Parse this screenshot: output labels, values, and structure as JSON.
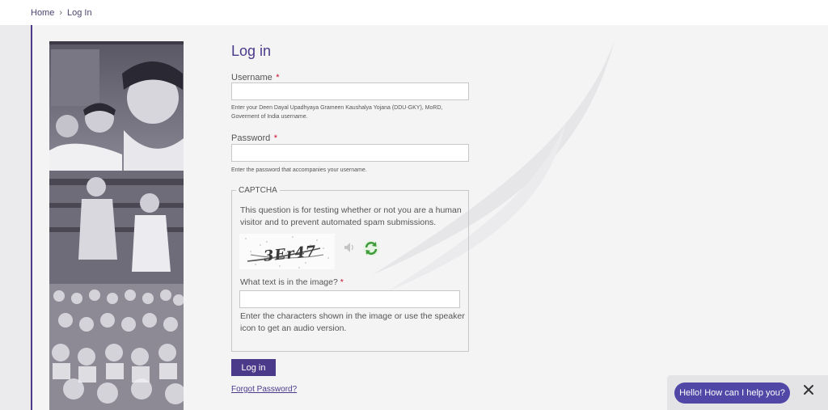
{
  "breadcrumb": {
    "home": "Home",
    "separator": "›",
    "current": "Log In"
  },
  "form": {
    "title": "Log in",
    "username": {
      "label": "Username",
      "required_mark": "*",
      "value": "",
      "help": "Enter your Deen Dayal Upadhyaya Grameen Kaushalya Yojana (DDU-GKY), MoRD, Goverment of India username."
    },
    "password": {
      "label": "Password",
      "required_mark": "*",
      "value": "",
      "help": "Enter the password that accompanies your username."
    },
    "captcha": {
      "legend": "CAPTCHA",
      "description": "This question is for testing whether or not you are a human visitor and to prevent automated spam submissions.",
      "image_text": "3Er47",
      "question": "What text is in the image?",
      "required_mark": "*",
      "value": "",
      "help": "Enter the characters shown in the image or use the speaker icon to get an audio version."
    },
    "submit_label": "Log in",
    "forgot_label": "Forgot Password?"
  },
  "chat": {
    "greeting": "Hello! How can I help you?",
    "close_icon": "close-icon"
  },
  "colors": {
    "accent": "#4b3a8a",
    "chat_bubble": "#5147a6",
    "required": "#c8102e"
  }
}
